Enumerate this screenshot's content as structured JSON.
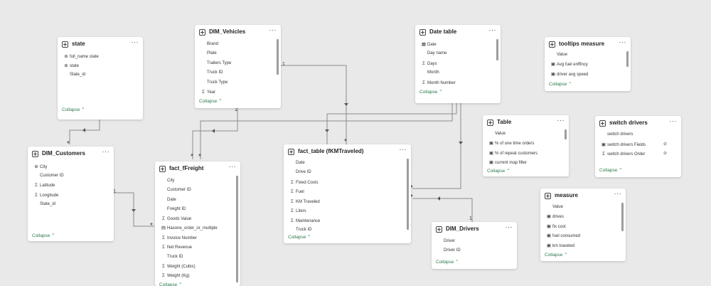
{
  "labels": {
    "collapse": "Collapse ⌃",
    "more": "···",
    "one": "1",
    "many": "*"
  },
  "tables": {
    "state": {
      "title": "state",
      "fields": [
        "full_name state",
        "state",
        "State_id"
      ]
    },
    "dim_vehicles": {
      "title": "DIM_Vehicles",
      "fields": [
        "Brand",
        "Plate",
        "Trailers Type",
        "Truck ID",
        "Truck Type",
        "Year"
      ]
    },
    "date_table": {
      "title": "Date table",
      "fields": [
        "Date",
        "Day name",
        "Days",
        "Month",
        "Month Number"
      ]
    },
    "tooltips_measure": {
      "title": "tooltips measure",
      "fields": [
        "Value",
        "Avg fuel enffincy",
        "driver avg speed"
      ]
    },
    "table": {
      "title": "Table",
      "fields": [
        "Value",
        "% of one time orders",
        "% of repeat customers",
        "current map filter"
      ]
    },
    "switch_drivers": {
      "title": "switch drivers",
      "fields": [
        "switch drivers",
        "switch drivers Fields",
        "switch drivers Order"
      ]
    },
    "dim_customers": {
      "title": "DIM_Customers",
      "fields": [
        "City",
        "Customer ID",
        "Latitude",
        "Longitude",
        "State_id"
      ]
    },
    "fact_ffreight": {
      "title": "fact_fFreight",
      "fields": [
        "City",
        "Customer ID",
        "Date",
        "Freight ID",
        "Goods Value",
        "Hasone_order_or_multiple",
        "Invoice Number",
        "Net Revenue",
        "Truck ID",
        "Weight (Cubic)",
        "Weight (Kg)"
      ]
    },
    "fact_table": {
      "title": "fact_table (fKMTraveled)",
      "fields": [
        "Date",
        "Drive ID",
        "Fixed Costs",
        "Fuel",
        "KM Traveled",
        "Liters",
        "Maintenance",
        "Truck ID"
      ]
    },
    "dim_drivers": {
      "title": "DIM_Drivers",
      "fields": [
        "Driver",
        "Driver ID"
      ]
    },
    "measure": {
      "title": "measure",
      "fields": [
        "Value",
        "drives",
        "fix cost",
        "fuel consumed",
        "km traveled"
      ]
    }
  }
}
